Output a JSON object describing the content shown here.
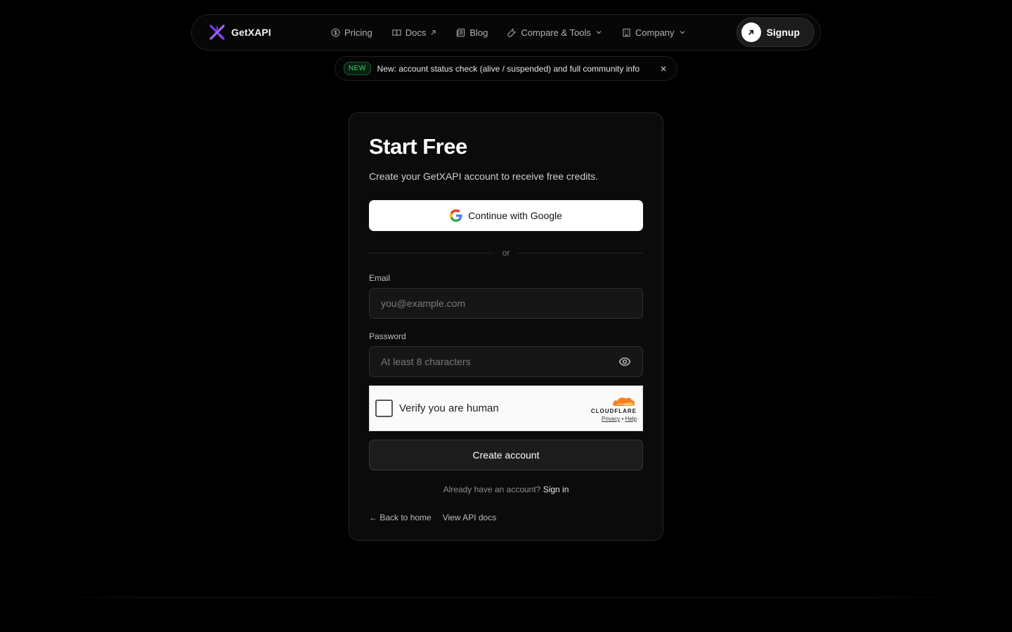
{
  "nav": {
    "brand": "GetXAPI",
    "links": [
      {
        "label": "Pricing",
        "icon": "dollar-circle-icon"
      },
      {
        "label": "Docs",
        "icon": "book-icon"
      },
      {
        "label": "Blog",
        "icon": "newspaper-icon"
      },
      {
        "label": "Compare & Tools",
        "icon": "wrench-icon"
      },
      {
        "label": "Company",
        "icon": "building-icon"
      }
    ],
    "signup": "Signup"
  },
  "announcement": {
    "badge": "NEW",
    "text": "New: account status check (alive / suspended) and full community info"
  },
  "card": {
    "title": "Start Free",
    "subtitle": "Create your GetXAPI account to receive free credits.",
    "google_button": "Continue with Google",
    "divider": "or",
    "email_label": "Email",
    "email_placeholder": "you@example.com",
    "email_value": "",
    "password_label": "Password",
    "password_placeholder": "At least 8 characters",
    "password_value": "",
    "captcha": {
      "text": "Verify you are human",
      "brand": "CLOUDFLARE",
      "privacy": "Privacy",
      "separator": "•",
      "help": "Help"
    },
    "create_button": "Create account",
    "signin_prompt": "Already have an account?",
    "signin_link": "Sign in",
    "back_home": "← Back to home",
    "api_docs": "View API docs"
  },
  "colors": {
    "background": "#000000",
    "accent_purple": "#8b3dff",
    "badge_green": "#3ccf7a",
    "cloudflare_orange": "#f38020"
  }
}
